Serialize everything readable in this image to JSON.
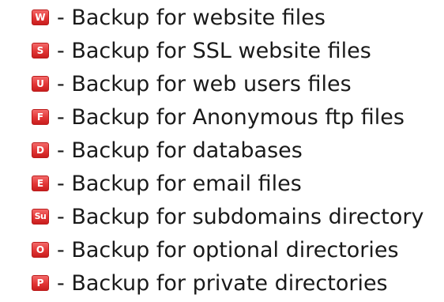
{
  "legend": {
    "items": [
      {
        "icon": "W",
        "icon_name": "website-files-icon",
        "label": "- Backup for website files"
      },
      {
        "icon": "S",
        "icon_name": "ssl-website-files-icon",
        "label": "- Backup for SSL website files"
      },
      {
        "icon": "U",
        "icon_name": "web-users-files-icon",
        "label": "- Backup for web users files"
      },
      {
        "icon": "F",
        "icon_name": "anonymous-ftp-files-icon",
        "label": "- Backup for Anonymous ftp files"
      },
      {
        "icon": "D",
        "icon_name": "databases-icon",
        "label": "- Backup for databases"
      },
      {
        "icon": "E",
        "icon_name": "email-files-icon",
        "label": "- Backup for email files"
      },
      {
        "icon": "Su",
        "icon_name": "subdomains-directory-icon",
        "label": "- Backup for subdomains directory"
      },
      {
        "icon": "O",
        "icon_name": "optional-directories-icon",
        "label": "- Backup for optional directories"
      },
      {
        "icon": "P",
        "icon_name": "private-directories-icon",
        "label": "- Backup for private directories"
      }
    ],
    "badge_color": "#e23535",
    "text_color": "#1a1a1a"
  }
}
